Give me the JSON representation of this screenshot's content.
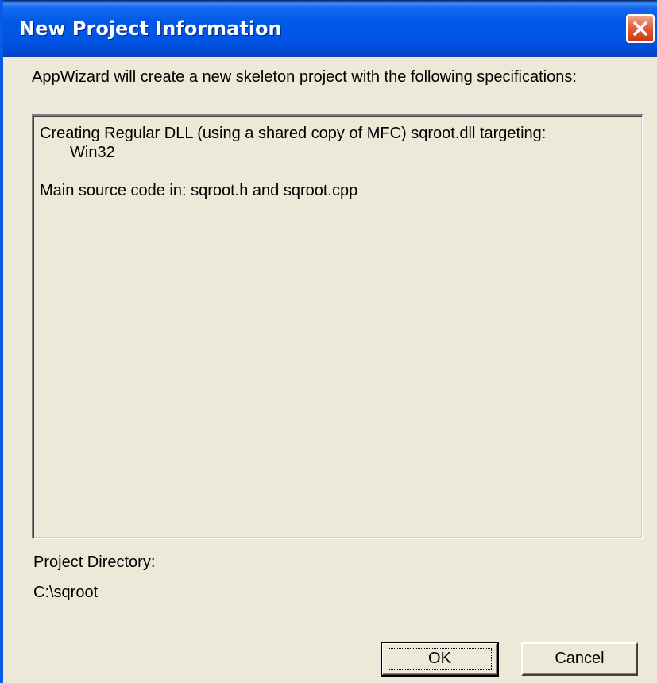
{
  "window": {
    "title": "New Project Information"
  },
  "titlebar": {
    "close_icon": "close-x-icon",
    "close_color": "#e2613c",
    "color": "#0058e6"
  },
  "dialog": {
    "intro_text": "AppWizard will create a new skeleton project with the following specifications:",
    "spec_lines": [
      "Creating Regular DLL (using a shared copy of MFC) sqroot.dll targeting:",
      "Win32",
      "Main source code in: sqroot.h and sqroot.cpp"
    ],
    "project_directory_label": "Project Directory:",
    "project_directory_value": "C:\\sqroot"
  },
  "buttons": {
    "ok_label": "OK",
    "cancel_label": "Cancel"
  }
}
